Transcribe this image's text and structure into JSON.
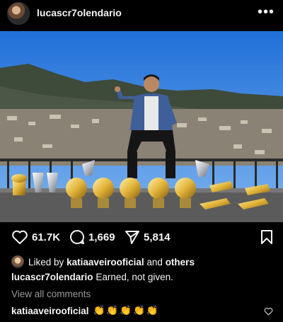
{
  "header": {
    "username": "lucascr7olendario",
    "more_icon": "more-horizontal-icon",
    "more_label": "•••"
  },
  "actions": {
    "likes": "61.7K",
    "comments": "1,669",
    "shares": "5,814"
  },
  "liked_by": {
    "prefix": "Liked by",
    "user": "katiaaveirooficial",
    "connector": "and",
    "others": "others"
  },
  "caption": {
    "user": "lucascr7olendario",
    "text": "Earned, not given."
  },
  "view_all": "View all comments",
  "comment": {
    "user": "katiaaveirooficial",
    "text": "👏👏👏👏👏"
  }
}
